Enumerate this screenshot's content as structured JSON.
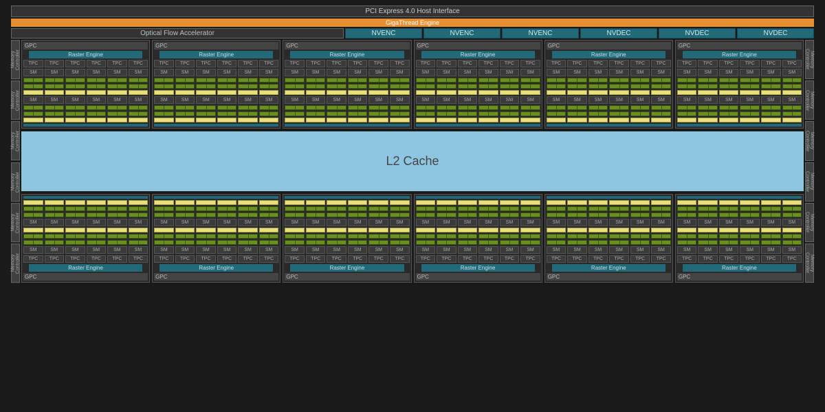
{
  "pci": "PCI Express 4.0 Host Interface",
  "giga": "GigaThread Engine",
  "ofa": "Optical Flow Accelerator",
  "codecs": [
    "NVENC",
    "NVENC",
    "NVENC",
    "NVDEC",
    "NVDEC",
    "NVDEC"
  ],
  "memoryController": "Memory Controller",
  "gpc": "GPC",
  "raster": "Raster Engine",
  "tpc": "TPC",
  "sm": "SM",
  "l2": "L2 Cache",
  "layout": {
    "gpc_count_per_row": 6,
    "tpc_per_gpc": 6,
    "sm_per_tpc": 1,
    "sm_rows_per_gpc": 2,
    "memory_controllers_per_side": 6
  }
}
